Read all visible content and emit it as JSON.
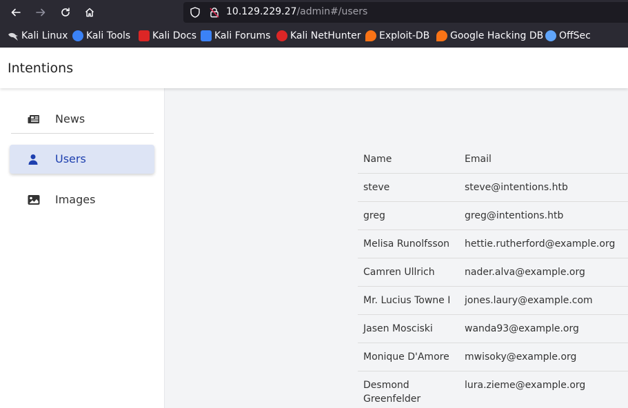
{
  "browser": {
    "url_host": "10.129.229.27",
    "url_path": "/admin#/users",
    "bookmarks": [
      {
        "label": "Kali Linux",
        "icon": "kali-dragon-icon",
        "color": "#3b82f6"
      },
      {
        "label": "Kali Tools",
        "icon": "kali-tools-icon",
        "color": "#e11d48"
      },
      {
        "label": "Kali Docs",
        "icon": "kali-docs-icon",
        "color": "#dc2626"
      },
      {
        "label": "Kali Forums",
        "icon": "kali-forums-icon",
        "color": "#3b82f6"
      },
      {
        "label": "Kali NetHunter",
        "icon": "nethunter-icon",
        "color": "#dc2626"
      },
      {
        "label": "Exploit-DB",
        "icon": "exploit-db-icon",
        "color": "#f97316"
      },
      {
        "label": "Google Hacking DB",
        "icon": "ghdb-icon",
        "color": "#f97316"
      },
      {
        "label": "OffSec",
        "icon": "offsec-icon",
        "color": "#60a5fa"
      }
    ]
  },
  "app": {
    "brand": "Intentions"
  },
  "sidebar": {
    "items": [
      {
        "label": "News",
        "icon": "newspaper-icon",
        "active": false
      },
      {
        "label": "Users",
        "icon": "user-icon",
        "active": true
      },
      {
        "label": "Images",
        "icon": "image-icon",
        "active": false
      }
    ]
  },
  "users_table": {
    "headers": [
      "Name",
      "Email"
    ],
    "rows": [
      [
        "steve",
        "steve@intentions.htb"
      ],
      [
        "greg",
        "greg@intentions.htb"
      ],
      [
        "Melisa Runolfsson",
        "hettie.rutherford@example.org"
      ],
      [
        "Camren Ullrich",
        "nader.alva@example.org"
      ],
      [
        "Mr. Lucius Towne I",
        "jones.laury@example.com"
      ],
      [
        "Jasen Mosciski",
        "wanda93@example.org"
      ],
      [
        "Monique D'Amore",
        "mwisoky@example.org"
      ],
      [
        "Desmond Greenfelder",
        "lura.zieme@example.org"
      ]
    ]
  },
  "colors": {
    "accent": "#1e40af",
    "active_bg": "#dde4f5"
  }
}
